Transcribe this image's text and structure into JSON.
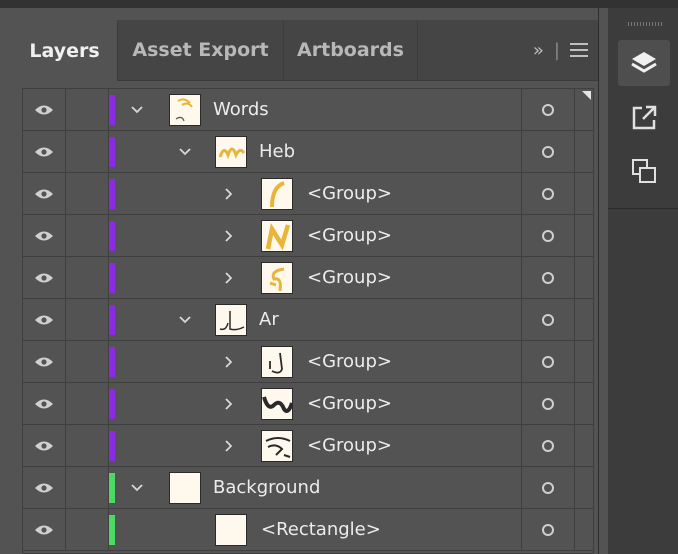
{
  "tabs": [
    {
      "label": "Layers",
      "active": true
    },
    {
      "label": "Asset Export",
      "active": false
    },
    {
      "label": "Artboards",
      "active": false
    }
  ],
  "panel_menu": {
    "expand_glyph": "»",
    "separator": "|"
  },
  "colors": {
    "layer_words": "#8a2be2",
    "layer_background": "#4cd964",
    "thumb_ink": "#e8b53a",
    "ar_ink": "#2a2a2a"
  },
  "layers": {
    "row0": {
      "label": "Words",
      "expanded": true,
      "color": "#8a2be2"
    },
    "row1": {
      "label": "Heb",
      "expanded": true,
      "color": "#8a2be2"
    },
    "row2": {
      "label": "<Group>",
      "expanded": false
    },
    "row3": {
      "label": "<Group>",
      "expanded": false
    },
    "row4": {
      "label": "<Group>",
      "expanded": false
    },
    "row5": {
      "label": "Ar",
      "expanded": true
    },
    "row6": {
      "label": "<Group>",
      "expanded": false
    },
    "row7": {
      "label": "<Group>",
      "expanded": false
    },
    "row8": {
      "label": "<Group>",
      "expanded": false
    },
    "row9": {
      "label": "Background",
      "expanded": true,
      "color": "#4cd964"
    },
    "row10": {
      "label": "<Rectangle>",
      "expanded": false
    }
  },
  "dock_icons": [
    "layers-icon",
    "export-icon",
    "artboards-icon"
  ]
}
